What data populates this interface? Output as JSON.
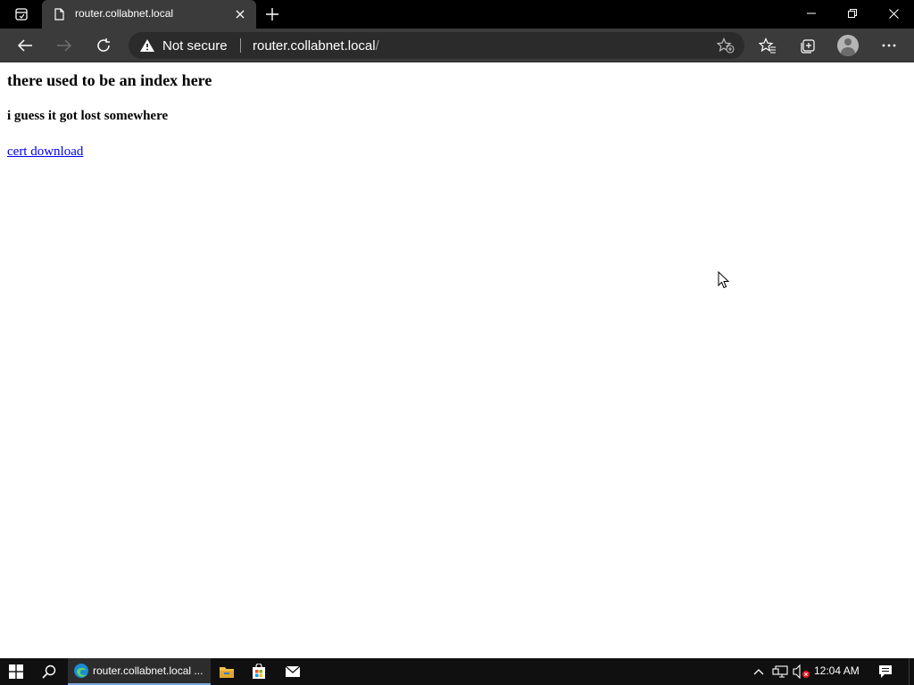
{
  "browser": {
    "tab": {
      "title": "router.collabnet.local",
      "icon": "page-icon"
    },
    "address": {
      "security_label": "Not secure",
      "url_host": "router.collabnet.local",
      "url_path": "/"
    },
    "icons": {
      "tab_actions": "tab-actions-icon",
      "close_tab": "close-icon",
      "new_tab": "plus-icon",
      "back": "arrow-left-icon",
      "forward": "arrow-right-icon",
      "refresh": "refresh-icon",
      "warning": "warning-icon",
      "add_favorite": "star-plus-icon",
      "favorites": "favorites-icon",
      "collections": "collections-icon",
      "profile": "profile-icon",
      "more": "ellipsis-icon",
      "minimize": "minimize-icon",
      "restore": "restore-icon",
      "close_window": "close-icon"
    }
  },
  "page": {
    "heading": "there used to be an index here",
    "subheading": "i guess it got lost somewhere",
    "link_text": "cert download"
  },
  "taskbar": {
    "edge_label": "router.collabnet.local ...",
    "clock": "12:04 AM",
    "icons": [
      "windows-start-icon",
      "search-icon",
      "edge-icon",
      "file-explorer-icon",
      "store-icon",
      "mail-icon",
      "chevron-up-icon",
      "network-icon",
      "volume-muted-icon",
      "notification-icon"
    ]
  },
  "colors": {
    "titlebar": "#000000",
    "toolbar": "#3b3b3b",
    "addressbar": "#2b2b2b",
    "link": "#0000ee",
    "taskbar": "#101010"
  }
}
